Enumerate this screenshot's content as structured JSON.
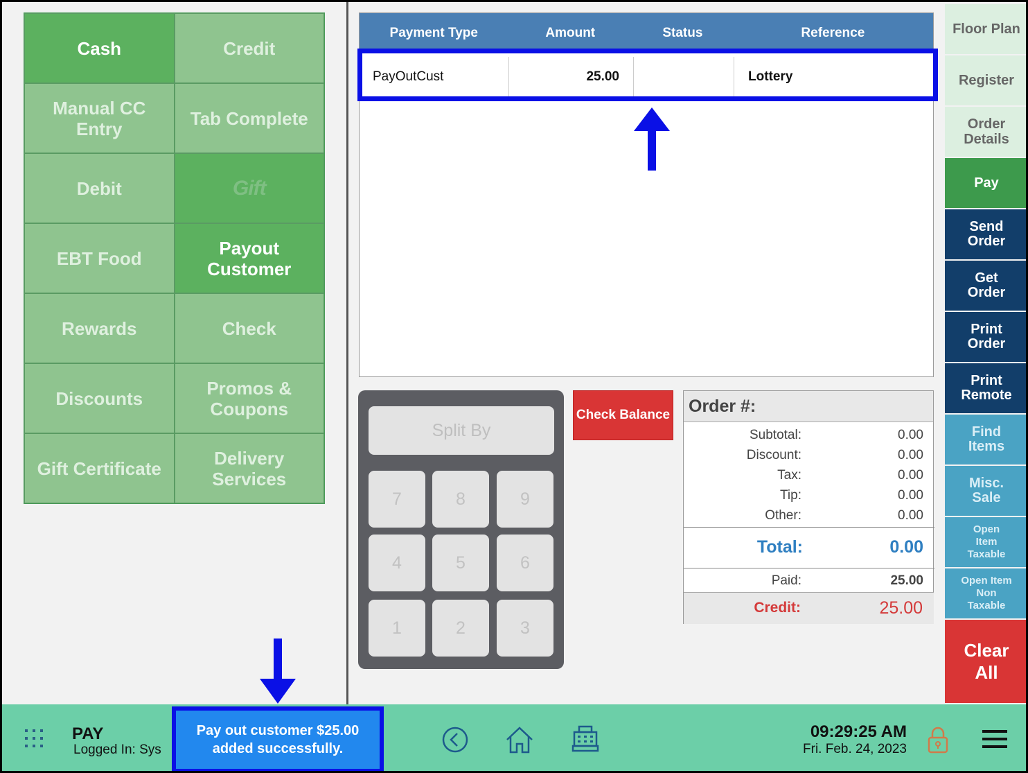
{
  "tender_buttons": [
    {
      "label": "Cash",
      "active": true
    },
    {
      "label": "Credit",
      "active": false
    },
    {
      "label": "Manual CC Entry",
      "active": false
    },
    {
      "label": "Tab Complete",
      "active": false
    },
    {
      "label": "Debit",
      "active": false
    },
    {
      "label": "Gift",
      "active": true
    },
    {
      "label": "EBT Food",
      "active": false
    },
    {
      "label": "Payout Customer",
      "active": true
    },
    {
      "label": "Rewards",
      "active": false
    },
    {
      "label": "Check",
      "active": false
    },
    {
      "label": "Discounts",
      "active": false
    },
    {
      "label": "Promos & Coupons",
      "active": false
    },
    {
      "label": "Gift Certificate",
      "active": false
    },
    {
      "label": "Delivery Services",
      "active": false
    }
  ],
  "payments": {
    "headers": [
      "Payment Type",
      "Amount",
      "Status",
      "Reference"
    ],
    "rows": [
      {
        "type": "PayOutCust",
        "amount": "25.00",
        "status": "",
        "reference": "Lottery"
      }
    ]
  },
  "keypad": {
    "split_by": "Split By",
    "keys": [
      "7",
      "8",
      "9",
      "4",
      "5",
      "6",
      "1",
      "2",
      "3"
    ]
  },
  "check_balance": "Check Balance",
  "summary": {
    "title": "Order #:",
    "subtotal_label": "Subtotal:",
    "subtotal": "0.00",
    "discount_label": "Discount:",
    "discount": "0.00",
    "tax_label": "Tax:",
    "tax": "0.00",
    "tip_label": "Tip:",
    "tip": "0.00",
    "other_label": "Other:",
    "other": "0.00",
    "total_label": "Total:",
    "total": "0.00",
    "paid_label": "Paid:",
    "paid": "25.00",
    "credit_label": "Credit:",
    "credit": "25.00"
  },
  "nav": {
    "floor_plan": "Floor Plan",
    "register": "Register",
    "order_details": "Order Details",
    "pay": "Pay",
    "send_order": "Send Order",
    "get_order": "Get Order",
    "print_order": "Print Order",
    "print_remote": "Print Remote",
    "find_items": "Find Items",
    "misc_sale": "Misc. Sale",
    "open_item_taxable": "Open Item Taxable",
    "open_item_non_taxable": "Open Item Non Taxable",
    "clear_all": "Clear All"
  },
  "footer": {
    "screen_name": "PAY",
    "logged_in": "Logged In:  Sys",
    "toast": "Pay out customer $25.00 added successfully.",
    "time": "09:29:25 AM",
    "date": "Fri. Feb. 24, 2023"
  },
  "colors": {
    "tender_active": "#5cb15f",
    "tender_inactive": "#8fc48f",
    "table_header": "#4a7fb4",
    "highlight": "#0a10e6",
    "footer": "#6ccfa8",
    "nav_dark": "#123e6a",
    "nav_teal": "#4aa3c4",
    "clear_all": "#d93535"
  },
  "icons": [
    "grid-menu-icon",
    "back-circle-icon",
    "home-icon",
    "register-icon",
    "lock-icon",
    "hamburger-menu-icon",
    "up-arrow-annotation",
    "down-arrow-annotation"
  ]
}
